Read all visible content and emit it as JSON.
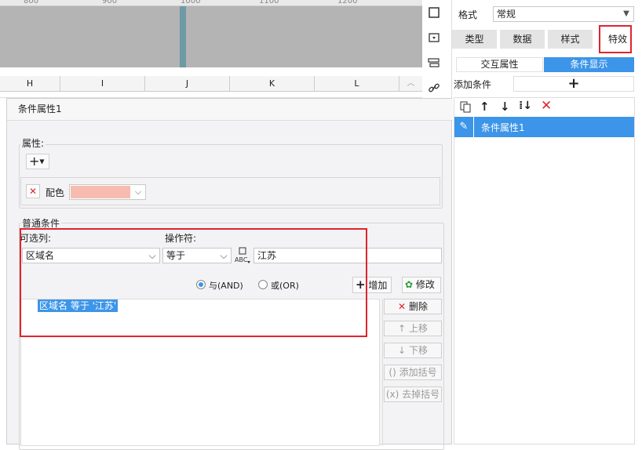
{
  "ruler": {
    "ticks": [
      "800",
      "900",
      "1000",
      "1100",
      "1200"
    ]
  },
  "grid": {
    "columns": [
      "H",
      "I",
      "J",
      "K",
      "L"
    ]
  },
  "panel": {
    "format_label": "格式",
    "format_value": "常规",
    "tabs": [
      "类型",
      "数据",
      "样式",
      "特效"
    ],
    "subtabs": [
      "交互属性",
      "条件显示"
    ],
    "add_condition_label": "添加条件",
    "add_icon": "+",
    "list_items": [
      "条件属性1"
    ]
  },
  "dialog": {
    "title": "条件属性1",
    "property_legend": "属性:",
    "color_label": "配色",
    "color_value": "#f7bcb0",
    "common_legend": "普通条件",
    "optional_col_label": "可选列:",
    "operator_label": "操作符:",
    "column_value": "区域名",
    "operator_value": "等于",
    "value_text": "江苏",
    "and_label": "与(AND)",
    "or_label": "或(OR)",
    "add_button": "增加",
    "modify_button": "修改",
    "condition_item": "区域名 等于 '江苏'",
    "delete_button": "删除",
    "move_up_button": "上移",
    "move_down_button": "下移",
    "add_bracket_button": "添加括号",
    "remove_bracket_button": "去掉括号"
  },
  "colors": {
    "accent": "#3c95e8",
    "highlight_red": "#e0242d"
  }
}
